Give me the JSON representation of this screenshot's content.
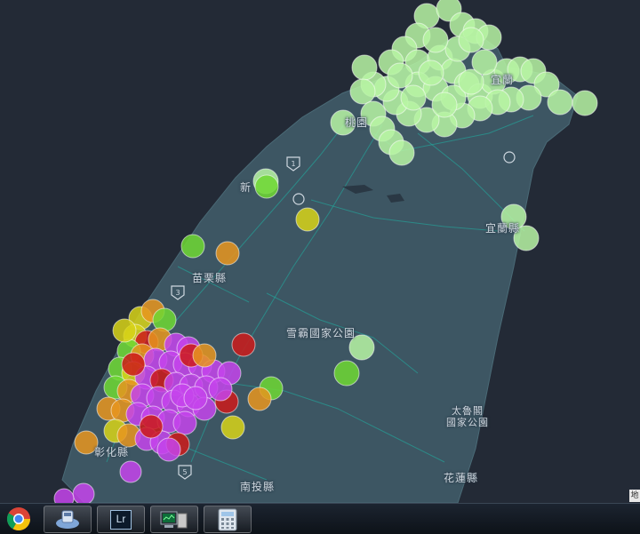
{
  "map": {
    "place_labels": {
      "xinzhu": "新",
      "taoyuan": "桃園",
      "yilan_top": "宜蘭",
      "yilan": "宜蘭縣",
      "miaoli": "苗栗縣",
      "shei_pa": "雪霸國家公園",
      "taroko_line1": "太魯閣",
      "taroko_line2": "國家公園",
      "changhua": "彰化縣",
      "nantou": "南投縣",
      "hualien": "花蓮縣"
    },
    "route_shields": [
      "1",
      "3",
      "5"
    ],
    "attribution": "地",
    "marker_colors": {
      "light_green": "#b7f5a3",
      "green": "#6ed832",
      "yellow": "#d8d417",
      "orange": "#e8951e",
      "red": "#cc1a1a",
      "purple": "#c644ec"
    }
  },
  "taskbar": {
    "items": [
      "chrome",
      "sd-card-utility",
      "lightroom",
      "system-monitor",
      "calculator"
    ],
    "lightroom_label": "Lr"
  }
}
